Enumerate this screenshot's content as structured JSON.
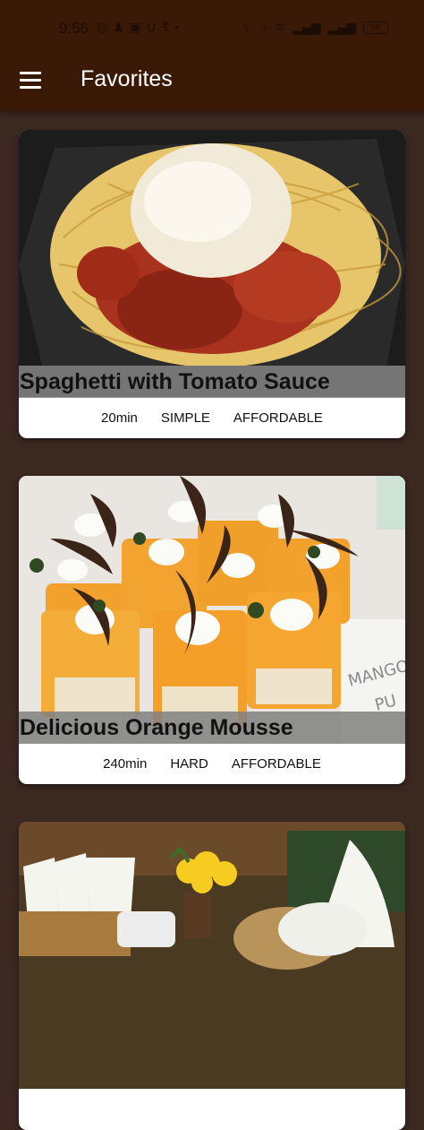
{
  "status_bar": {
    "time": "9:56",
    "left_icons": [
      "whatsapp-icon",
      "snapchat-icon",
      "linkedin-icon",
      "u-icon",
      "rupee-icon",
      "dot-icon"
    ],
    "right_icons": [
      "moon-icon",
      "mute-icon",
      "wifi-icon",
      "signal-icon",
      "signal-icon"
    ],
    "battery": "56"
  },
  "app_bar": {
    "title": "Favorites",
    "menu_icon": "hamburger-menu-icon"
  },
  "meals": [
    {
      "title": "Spaghetti with Tomato Sauce",
      "duration": "20min",
      "complexity": "SIMPLE",
      "affordability": "AFFORDABLE"
    },
    {
      "title": "Delicious Orange Mousse",
      "duration": "240min",
      "complexity": "HARD",
      "affordability": "AFFORDABLE"
    },
    {
      "title": "",
      "duration": "",
      "complexity": "",
      "affordability": ""
    }
  ],
  "colors": {
    "app_bar": "#3a1a07",
    "background": "#3b2820",
    "title_overlay": "#808080"
  }
}
